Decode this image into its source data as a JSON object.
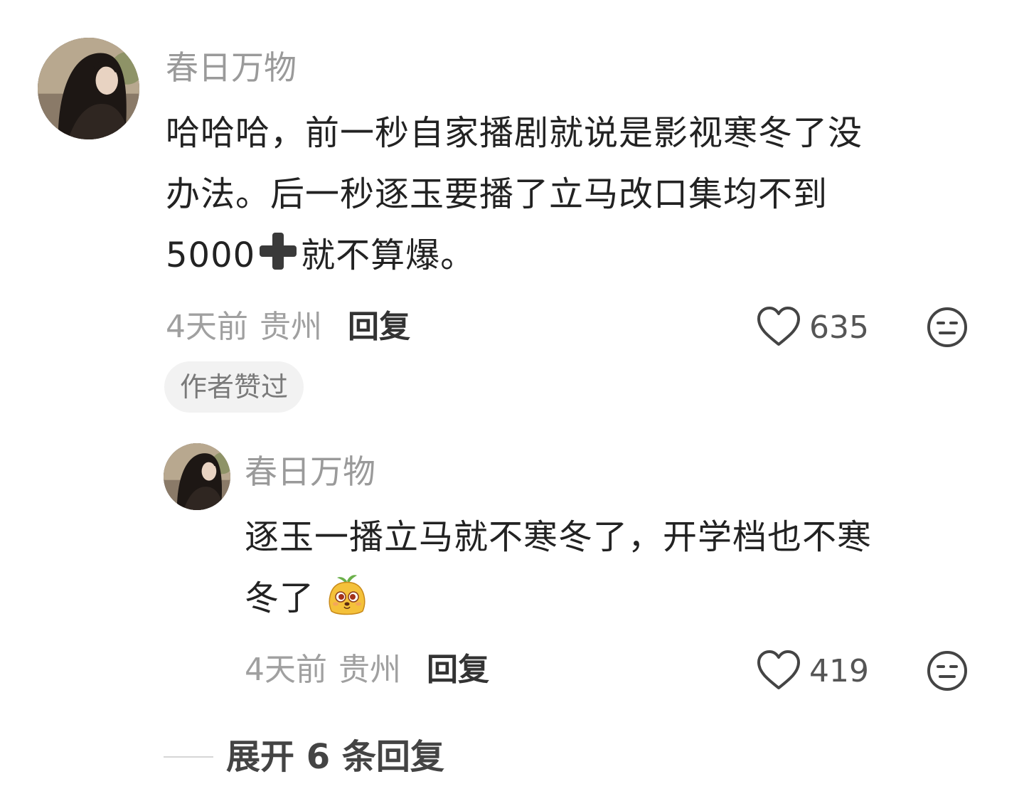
{
  "comment": {
    "username": "春日万物",
    "text_line1": "哈哈哈，前一秒自家播剧就说是影视寒冬了没",
    "text_line2": "办法。后一秒逐玉要播了立马改口集均不到",
    "text_line3_prefix": "5000",
    "text_line3_icon": "plus-emoji-icon",
    "text_line3_suffix": "就不算爆。",
    "time": "4天前",
    "location": "贵州",
    "reply_label": "回复",
    "like_count": "635",
    "badge": "作者赞过"
  },
  "reply": {
    "username": "春日万物",
    "text_line1": "逐玉一播立马就不寒冬了，开学档也不寒",
    "text_line2": "冬了",
    "text_emoji": "dog-face-emoji-icon",
    "time": "4天前",
    "location": "贵州",
    "reply_label": "回复",
    "like_count": "419"
  },
  "expand": {
    "label": "展开 6 条回复"
  },
  "colors": {
    "username": "#9a9a9a",
    "body_text": "#222222",
    "meta_text": "#a0a0a0",
    "badge_bg": "#f2f2f2"
  }
}
